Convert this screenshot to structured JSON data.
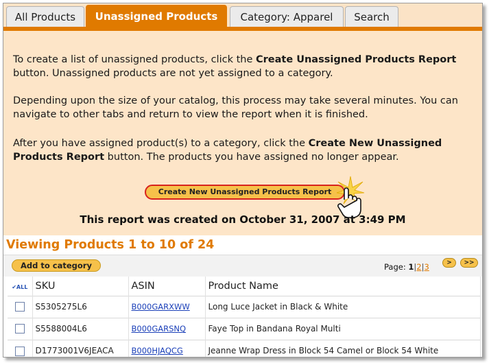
{
  "tabs": [
    {
      "label": "All Products",
      "active": false
    },
    {
      "label": "Unassigned Products",
      "active": true
    },
    {
      "label": "Category: Apparel",
      "active": false
    },
    {
      "label": "Search",
      "active": false
    }
  ],
  "info": {
    "p1_pre": "To create a list of unassigned products, click the ",
    "p1_bold": "Create Unassigned Products Report",
    "p1_post": " button. Unassigned products are not yet assigned to a category.",
    "p2": "Depending upon the size of your catalog, this process may take several minutes. You can navigate to other tabs and return to view the report when it is finished.",
    "p3_pre": "After you have assigned product(s) to a category, click the ",
    "p3_bold": "Create New Unassigned Products Report",
    "p3_post": " button. The products you have assigned no longer appear.",
    "create_button_label": "Create New Unassigned Products Report",
    "report_created": "This report was created on October 31, 2007 at 3:49 PM"
  },
  "listing": {
    "viewing_text": "Viewing Products 1 to 10 of 24",
    "add_button_label": "Add to category",
    "pager_label": "Page:",
    "current_page": "1",
    "pages": [
      "2",
      "3"
    ],
    "next_label": ">",
    "last_label": ">>",
    "all_label": "ALL"
  },
  "table": {
    "headers": [
      "SKU",
      "ASIN",
      "Product Name"
    ],
    "rows": [
      {
        "sku": "S5305275L6",
        "asin": "B000GARXWW",
        "name": "Long Luce Jacket in Black & White"
      },
      {
        "sku": "S5588004L6",
        "asin": "B000GARSNQ",
        "name": "Faye Top in Bandana Royal Multi"
      },
      {
        "sku": "D1773001V6JEACA",
        "asin": "B000HJAQCG",
        "name": "Jeanne Wrap Dress in Block 54 Camel or Block 54 White"
      }
    ]
  },
  "colors": {
    "accent": "#e07a00",
    "panel": "#fde5c8",
    "button": "#f6c14a",
    "highlight": "#d8221e",
    "link": "#1a3fb8"
  }
}
